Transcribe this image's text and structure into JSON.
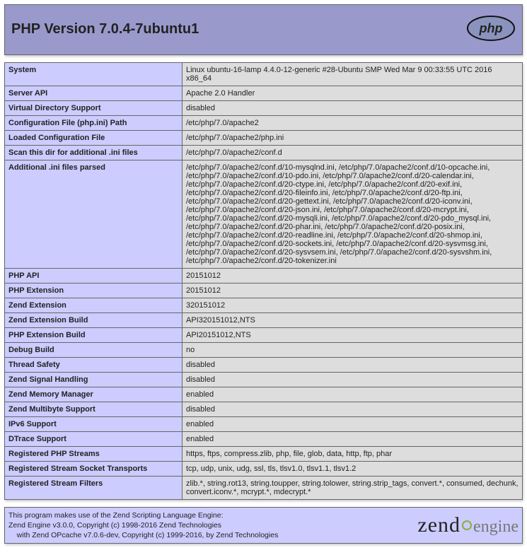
{
  "header": {
    "title": "PHP Version 7.0.4-7ubuntu1",
    "logo_alt": "php"
  },
  "rows": [
    {
      "label": "System",
      "value": "Linux ubuntu-16-lamp 4.4.0-12-generic #28-Ubuntu SMP Wed Mar 9 00:33:55 UTC 2016 x86_64"
    },
    {
      "label": "Server API",
      "value": "Apache 2.0 Handler"
    },
    {
      "label": "Virtual Directory Support",
      "value": "disabled"
    },
    {
      "label": "Configuration File (php.ini) Path",
      "value": "/etc/php/7.0/apache2"
    },
    {
      "label": "Loaded Configuration File",
      "value": "/etc/php/7.0/apache2/php.ini"
    },
    {
      "label": "Scan this dir for additional .ini files",
      "value": "/etc/php/7.0/apache2/conf.d"
    },
    {
      "label": "Additional .ini files parsed",
      "value": "/etc/php/7.0/apache2/conf.d/10-mysqlnd.ini, /etc/php/7.0/apache2/conf.d/10-opcache.ini, /etc/php/7.0/apache2/conf.d/10-pdo.ini, /etc/php/7.0/apache2/conf.d/20-calendar.ini, /etc/php/7.0/apache2/conf.d/20-ctype.ini, /etc/php/7.0/apache2/conf.d/20-exif.ini, /etc/php/7.0/apache2/conf.d/20-fileinfo.ini, /etc/php/7.0/apache2/conf.d/20-ftp.ini, /etc/php/7.0/apache2/conf.d/20-gettext.ini, /etc/php/7.0/apache2/conf.d/20-iconv.ini, /etc/php/7.0/apache2/conf.d/20-json.ini, /etc/php/7.0/apache2/conf.d/20-mcrypt.ini, /etc/php/7.0/apache2/conf.d/20-mysqli.ini, /etc/php/7.0/apache2/conf.d/20-pdo_mysql.ini, /etc/php/7.0/apache2/conf.d/20-phar.ini, /etc/php/7.0/apache2/conf.d/20-posix.ini, /etc/php/7.0/apache2/conf.d/20-readline.ini, /etc/php/7.0/apache2/conf.d/20-shmop.ini, /etc/php/7.0/apache2/conf.d/20-sockets.ini, /etc/php/7.0/apache2/conf.d/20-sysvmsg.ini, /etc/php/7.0/apache2/conf.d/20-sysvsem.ini, /etc/php/7.0/apache2/conf.d/20-sysvshm.ini, /etc/php/7.0/apache2/conf.d/20-tokenizer.ini"
    },
    {
      "label": "PHP API",
      "value": "20151012"
    },
    {
      "label": "PHP Extension",
      "value": "20151012"
    },
    {
      "label": "Zend Extension",
      "value": "320151012"
    },
    {
      "label": "Zend Extension Build",
      "value": "API320151012,NTS"
    },
    {
      "label": "PHP Extension Build",
      "value": "API20151012,NTS"
    },
    {
      "label": "Debug Build",
      "value": "no"
    },
    {
      "label": "Thread Safety",
      "value": "disabled"
    },
    {
      "label": "Zend Signal Handling",
      "value": "disabled"
    },
    {
      "label": "Zend Memory Manager",
      "value": "enabled"
    },
    {
      "label": "Zend Multibyte Support",
      "value": "disabled"
    },
    {
      "label": "IPv6 Support",
      "value": "enabled"
    },
    {
      "label": "DTrace Support",
      "value": "enabled"
    },
    {
      "label": "Registered PHP Streams",
      "value": "https, ftps, compress.zlib, php, file, glob, data, http, ftp, phar"
    },
    {
      "label": "Registered Stream Socket Transports",
      "value": "tcp, udp, unix, udg, ssl, tls, tlsv1.0, tlsv1.1, tlsv1.2"
    },
    {
      "label": "Registered Stream Filters",
      "value": "zlib.*, string.rot13, string.toupper, string.tolower, string.strip_tags, convert.*, consumed, dechunk, convert.iconv.*, mcrypt.*, mdecrypt.*"
    }
  ],
  "credits": {
    "line1": "This program makes use of the Zend Scripting Language Engine:",
    "line2": "Zend Engine v3.0.0, Copyright (c) 1998-2016 Zend Technologies",
    "line3": "    with Zend OPcache v7.0.6-dev, Copyright (c) 1999-2016, by Zend Technologies",
    "logo_text1": "zend",
    "logo_text2": "engine"
  }
}
